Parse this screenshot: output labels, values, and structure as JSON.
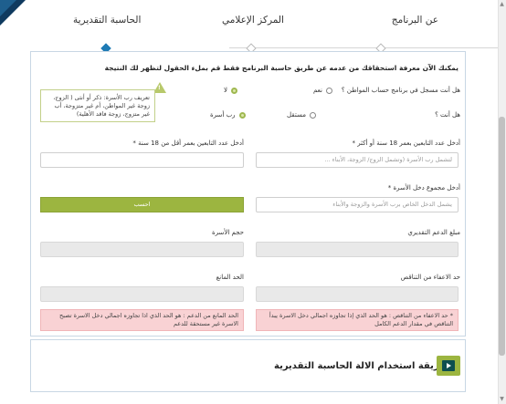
{
  "tabs": [
    {
      "label": "عن البرنامج"
    },
    {
      "label": "المركز الإعلامي"
    },
    {
      "label": "الحاسبة التقديرية"
    }
  ],
  "intro": "يمكنك الآن معرفة استحقاقك من عدمه عن طريق حاسبة البرنامج فقط قم بملء الحقول لتظهر لك النتيجة",
  "q1": {
    "label": "هل أنت مسجل في برنامج حساب المواطن ؟",
    "options": [
      "نعم",
      "لا"
    ],
    "selected": "لا"
  },
  "q2": {
    "label": "هل أنت ؟",
    "options": [
      "مستقل",
      "رب أسرة"
    ],
    "selected": "رب أسرة"
  },
  "tooltip": {
    "icon_text": "!",
    "text": "تعريف رب الأسرة: ذكر أو أنثى ( الزوج، زوجة غير المواطن، أم غير متزوجة، أب غير متزوج، زوجة فاقد الأهلية)"
  },
  "dependents_over_18": {
    "label": "أدخل عدد التابعين بعمر 18 سنة أو أكثر *",
    "placeholder": "لتشمل رب الأسرة (وتشمل الزوج/ الزوجة، الأبناء ..."
  },
  "dependents_under_18": {
    "label": "أدخل عدد التابعين بعمر أقل من 18 سنة *",
    "placeholder": ""
  },
  "family_income": {
    "label": "أدخل مجموع دخل الأسرة *",
    "placeholder": "يشمل الدخل الخاص برب الأسرة والزوجة والأبناء"
  },
  "calculate_button": "احسب",
  "estimated_support": {
    "label": "مبلغ الدعم التقديري",
    "value": ""
  },
  "family_size": {
    "label": "حجم الأسرة",
    "value": ""
  },
  "exemption_limit": {
    "label": "حد الاعفاء من التناقص",
    "value": ""
  },
  "max_limit": {
    "label": "الحد المانع",
    "value": ""
  },
  "note_exemption": "* حد الاعفاء من التناقص : هو الحد الذي إذا تجاوزه اجمالي دخل الاسرة يبدأ التناقص في مقدار الدعم الكامل",
  "note_max": "الحد المانع من الدعم : هو الحد الذي اذا تجاوزه اجمالي دخل الاسرة تصبح الاسرة غير مستحقة للدعم",
  "video": {
    "title": "طريقة استخدام الالة الحاسبة التقديرية",
    "icon": "video-play-icon"
  },
  "colors": {
    "accent_green": "#9cb540",
    "accent_blue": "#1f7bb5",
    "note_pink": "#f9d2d4",
    "corner_navy": "#0f3a5f"
  }
}
